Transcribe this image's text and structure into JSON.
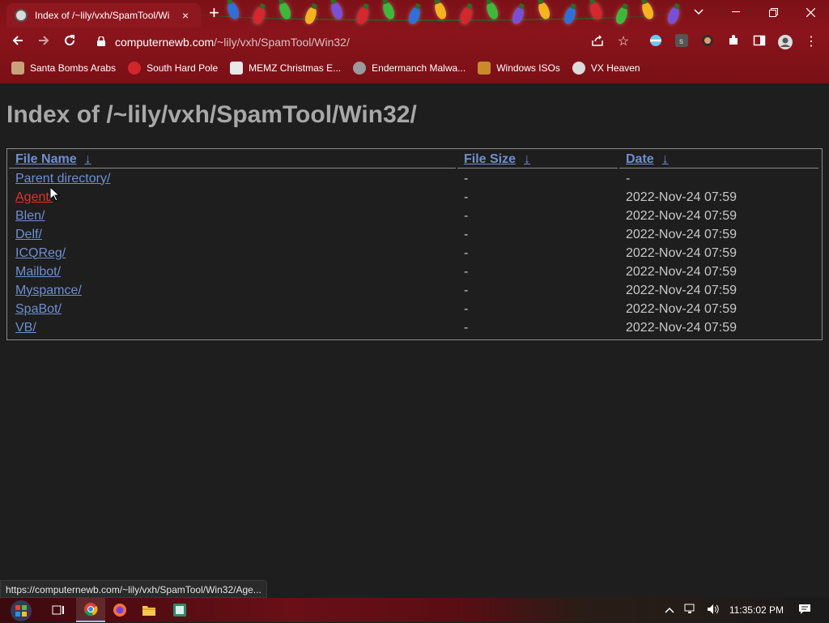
{
  "window": {
    "tab_title": "Index of /~lily/vxh/SpamTool/Wi",
    "new_tab": "+",
    "tab_close": "×"
  },
  "address": {
    "domain": "computernewb.com",
    "path": "/~lily/vxh/SpamTool/Win32/"
  },
  "bookmarks": [
    {
      "label": "Santa Bombs Arabs",
      "icon": "person-icon",
      "color": "#c9a27a"
    },
    {
      "label": "South Hard Pole",
      "icon": "snowflake-icon",
      "color": "#d2262d"
    },
    {
      "label": "MEMZ Christmas E...",
      "icon": "page-icon",
      "color": "#e8e8e8"
    },
    {
      "label": "Endermanch Malwa...",
      "icon": "enderman-icon",
      "color": "#9a9a9a"
    },
    {
      "label": "Windows ISOs",
      "icon": "tree-icon",
      "color": "#c98a2b"
    },
    {
      "label": "VX Heaven",
      "icon": "vx-icon",
      "color": "#dcdcdc"
    }
  ],
  "page": {
    "title": "Index of /~lily/vxh/SpamTool/Win32/",
    "columns": {
      "name": "File Name",
      "size": "File Size",
      "date": "Date",
      "sort_glyph": "↓"
    },
    "rows": [
      {
        "name": "Parent directory/",
        "size": "-",
        "date": "-"
      },
      {
        "name": "Agent/",
        "size": "-",
        "date": "2022-Nov-24 07:59"
      },
      {
        "name": "Blen/",
        "size": "-",
        "date": "2022-Nov-24 07:59"
      },
      {
        "name": "Delf/",
        "size": "-",
        "date": "2022-Nov-24 07:59"
      },
      {
        "name": "ICQReg/",
        "size": "-",
        "date": "2022-Nov-24 07:59"
      },
      {
        "name": "Mailbot/",
        "size": "-",
        "date": "2022-Nov-24 07:59"
      },
      {
        "name": "Myspamce/",
        "size": "-",
        "date": "2022-Nov-24 07:59"
      },
      {
        "name": "SpaBot/",
        "size": "-",
        "date": "2022-Nov-24 07:59"
      },
      {
        "name": "VB/",
        "size": "-",
        "date": "2022-Nov-24 07:59"
      }
    ]
  },
  "status_url": "https://computernewb.com/~lily/vxh/SpamTool/Win32/Age...",
  "taskbar": {
    "clock": "11:35:02 PM"
  },
  "colors": {
    "link": "#6f8fd1",
    "hover_link": "#e0322e",
    "chrome": "#8a141c"
  }
}
